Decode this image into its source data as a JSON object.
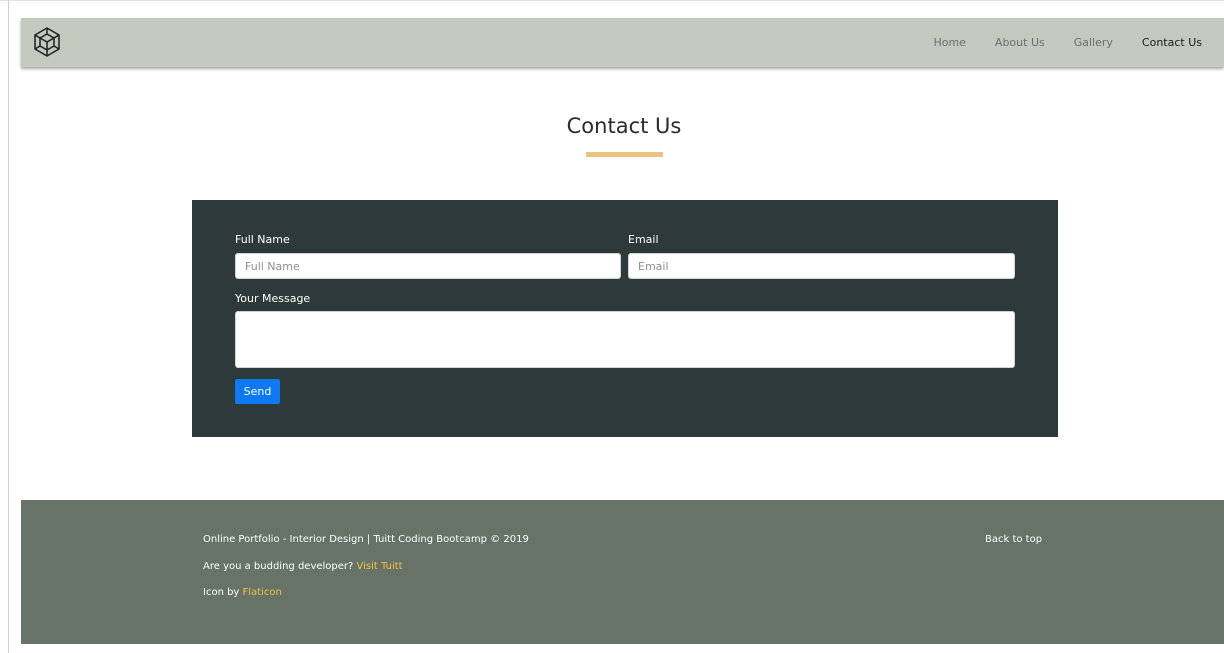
{
  "nav": {
    "logo_icon": "geometric-cube-icon",
    "links": [
      {
        "label": "Home"
      },
      {
        "label": "About Us"
      },
      {
        "label": "Gallery"
      },
      {
        "label": "Contact Us",
        "active": true
      }
    ]
  },
  "page": {
    "title": "Contact Us",
    "accent_color": "#e8c57d"
  },
  "form": {
    "panel_color": "#2e3a3a",
    "full_name": {
      "label": "Full Name",
      "placeholder": "Full Name",
      "value": ""
    },
    "email": {
      "label": "Email",
      "placeholder": "Email",
      "value": ""
    },
    "message": {
      "label": "Your Message",
      "value": ""
    },
    "send_label": "Send",
    "send_color": "#0d7af4"
  },
  "footer": {
    "background": "#667366",
    "credit": "Online Portfolio - Interior Design | Tuitt Coding Bootcamp © 2019",
    "developer_prompt": "Are you a budding developer?",
    "developer_link": "Visit Tuitt",
    "icon_prefix": "Icon by",
    "icon_link": "Flaticon",
    "back_to_top": "Back to top",
    "link_color": "#f2c041"
  }
}
